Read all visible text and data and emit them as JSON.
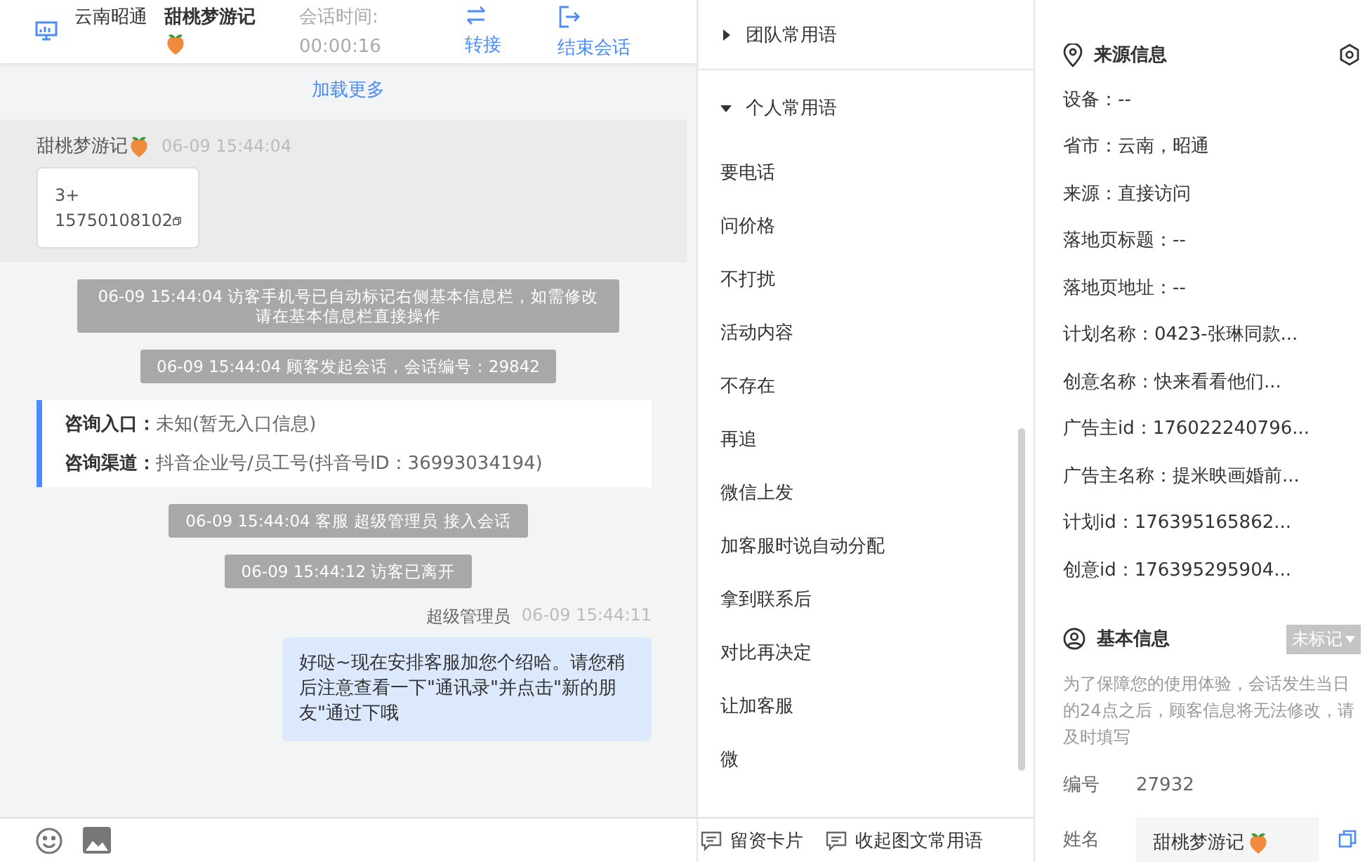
{
  "header": {
    "location": "云南昭通",
    "visitor": "甜桃梦游记",
    "timer_label": "会话时间:",
    "timer": "00:00:16",
    "actions": [
      {
        "kind": "transfer",
        "label": "转接"
      },
      {
        "kind": "end",
        "label": "结束会话"
      }
    ]
  },
  "chat": {
    "load_more": "加载更多",
    "messages": [
      {
        "kind": "visitor",
        "sender": "甜桃梦游记",
        "time": "06-09 15:44:04",
        "lines": [
          "3+",
          "15750108102"
        ]
      },
      {
        "kind": "notice",
        "text": "06-09 15:44:04 访客手机号已自动标记右侧基本信息栏，如需修改请在基本信息栏直接操作"
      },
      {
        "kind": "notice",
        "text": "06-09 15:44:04 顾客发起会话，会话编号：29842"
      },
      {
        "kind": "info",
        "rows": [
          {
            "label": "咨询入口：",
            "value": "未知(暂无入口信息)"
          },
          {
            "label": "咨询渠道：",
            "value": "抖音企业号/员工号(抖音号ID：36993034194)"
          }
        ]
      },
      {
        "kind": "notice",
        "text": "06-09 15:44:04 客服 超级管理员 接入会话"
      },
      {
        "kind": "notice",
        "text": "06-09 15:44:12 访客已离开"
      },
      {
        "kind": "agent",
        "sender": "超级管理员",
        "time": "06-09 15:44:11",
        "text": "好哒~现在安排客服加您个绍哈。请您稍后注意查看一下\"通讯录\"并点击\"新的朋友\"通过下哦"
      }
    ]
  },
  "phrases": {
    "groups": [
      {
        "label": "团队常用语",
        "expanded": false
      },
      {
        "label": "个人常用语",
        "expanded": true
      }
    ],
    "items": [
      "要电话",
      "问价格",
      "不打扰",
      "活动内容",
      "不存在",
      "再追",
      "微信上发",
      "加客服时说自动分配",
      "拿到联系后",
      "对比再决定",
      "让加客服",
      "微"
    ],
    "footer": [
      {
        "label": "留资卡片"
      },
      {
        "label": "收起图文常用语"
      }
    ]
  },
  "source": {
    "title": "来源信息",
    "rows": [
      "设备：--",
      "省市：云南，昭通",
      "来源：直接访问",
      "落地页标题：--",
      "落地页地址：--",
      "计划名称：0423-张琳同款...",
      "创意名称：快来看看他们...",
      "广告主id：176022240796...",
      "广告主名称：提米映画婚前...",
      "计划id：176395165862...",
      "创意id：176395295904..."
    ]
  },
  "basic": {
    "title": "基本信息",
    "tag": "未标记",
    "note": "为了保障您的使用体验，会话发生当日的24点之后，顾客信息将无法修改，请及时填写",
    "fields": [
      {
        "label": "编号",
        "value": "27932",
        "editable": false
      },
      {
        "label": "姓名",
        "value": "甜桃梦游记",
        "editable": true
      }
    ]
  }
}
